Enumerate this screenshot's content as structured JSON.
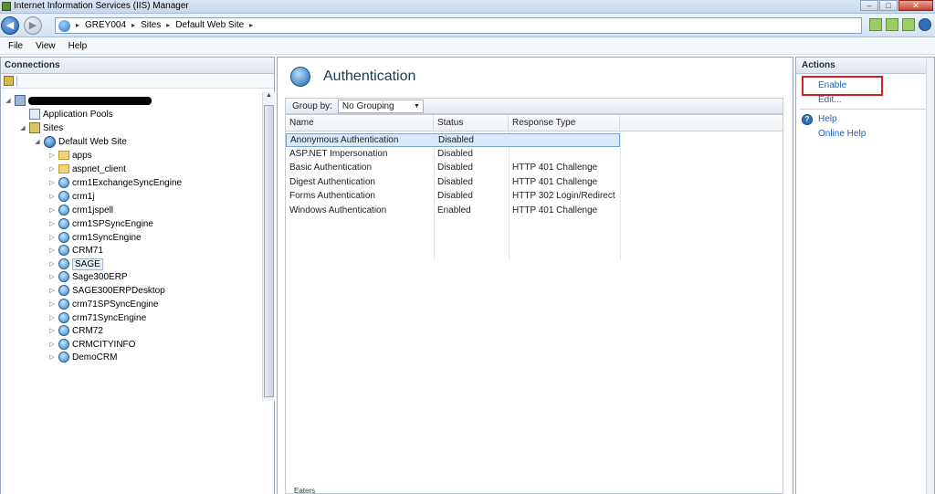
{
  "window": {
    "title": "Internet Information Services (IIS) Manager",
    "controls": [
      "–",
      "□",
      "✕"
    ]
  },
  "address": {
    "crumbs": [
      "GREY004",
      "Sites",
      "Default Web Site"
    ],
    "separator": "▸"
  },
  "menu": [
    "File",
    "View",
    "Help"
  ],
  "connections": {
    "title": "Connections",
    "server_label_redacted": true,
    "nodes": [
      {
        "label": "Application Pools",
        "icon": "pool-icon"
      },
      {
        "label": "Sites",
        "icon": "sites-icon"
      },
      {
        "label": "Default Web Site",
        "icon": "globe-icon"
      },
      {
        "label": "apps",
        "icon": "folder-icon"
      },
      {
        "label": "aspnet_client",
        "icon": "folder-icon"
      },
      {
        "label": "crm1ExchangeSyncEngine",
        "icon": "app-icon"
      },
      {
        "label": "crm1j",
        "icon": "app-icon"
      },
      {
        "label": "crm1jspell",
        "icon": "app-icon"
      },
      {
        "label": "crm1SPSyncEngine",
        "icon": "app-icon"
      },
      {
        "label": "crm1SyncEngine",
        "icon": "app-icon"
      },
      {
        "label": "CRM71",
        "icon": "app-icon"
      },
      {
        "label": "SAGE",
        "icon": "app-icon"
      },
      {
        "label": "Sage300ERP",
        "icon": "app-icon"
      },
      {
        "label": "SAGE300ERPDesktop",
        "icon": "app-icon"
      },
      {
        "label": "crm71SPSyncEngine",
        "icon": "app-icon"
      },
      {
        "label": "crm71SyncEngine",
        "icon": "app-icon"
      },
      {
        "label": "CRM72",
        "icon": "app-icon"
      },
      {
        "label": "CRMCITYINFO",
        "icon": "app-icon"
      },
      {
        "label": "DemoCRM",
        "icon": "app-icon"
      }
    ]
  },
  "feature": {
    "title": "Authentication",
    "groupby_label": "Group by:",
    "groupby_value": "No Grouping",
    "columns": [
      "Name",
      "Status",
      "Response Type"
    ],
    "rows": [
      {
        "name": "Anonymous Authentication",
        "status": "Disabled",
        "response": ""
      },
      {
        "name": "ASP.NET Impersonation",
        "status": "Disabled",
        "response": ""
      },
      {
        "name": "Basic Authentication",
        "status": "Disabled",
        "response": "HTTP 401 Challenge"
      },
      {
        "name": "Digest Authentication",
        "status": "Disabled",
        "response": "HTTP 401 Challenge"
      },
      {
        "name": "Forms Authentication",
        "status": "Disabled",
        "response": "HTTP 302 Login/Redirect"
      },
      {
        "name": "Windows Authentication",
        "status": "Enabled",
        "response": "HTTP 401 Challenge"
      }
    ],
    "bottom_text": "Eaters"
  },
  "actions": {
    "title": "Actions",
    "enable": "Enable",
    "edit": "Edit...",
    "help": "Help",
    "online_help": "Online Help"
  },
  "colors": {
    "link": "#1f5fb3",
    "highlight_box": "#d42020"
  }
}
